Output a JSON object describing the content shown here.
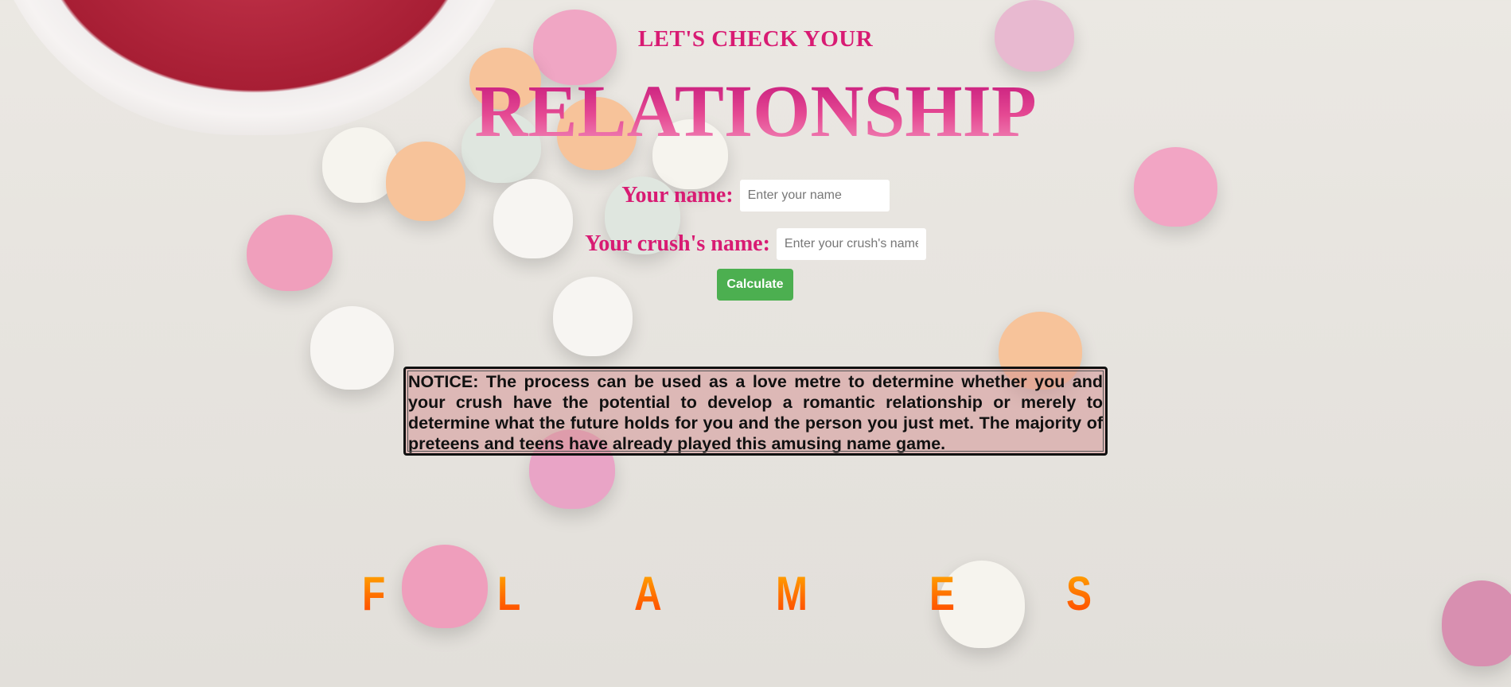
{
  "header": {
    "subtitle": "LET'S CHECK YOUR",
    "title": "RELATIONSHIP"
  },
  "form": {
    "your_name_label": "Your name:",
    "your_name_placeholder": "Enter your name",
    "crush_name_label": "Your crush's name:",
    "crush_name_placeholder": "Enter your crush's name",
    "calculate_label": "Calculate"
  },
  "notice": {
    "text": "NOTICE: The process can be used as a love metre to determine whether you and your crush have the potential to develop a romantic relationship or merely to determine what the future holds for you and the person you just met. The majority of preteens and teens have already played this amusing name game."
  },
  "flames": {
    "letters": [
      "F",
      "L",
      "A",
      "M",
      "E",
      "S"
    ]
  },
  "colors": {
    "accent_pink": "#d81b73",
    "button_green": "#4caf50",
    "flames_orange": "#ff6d00"
  }
}
